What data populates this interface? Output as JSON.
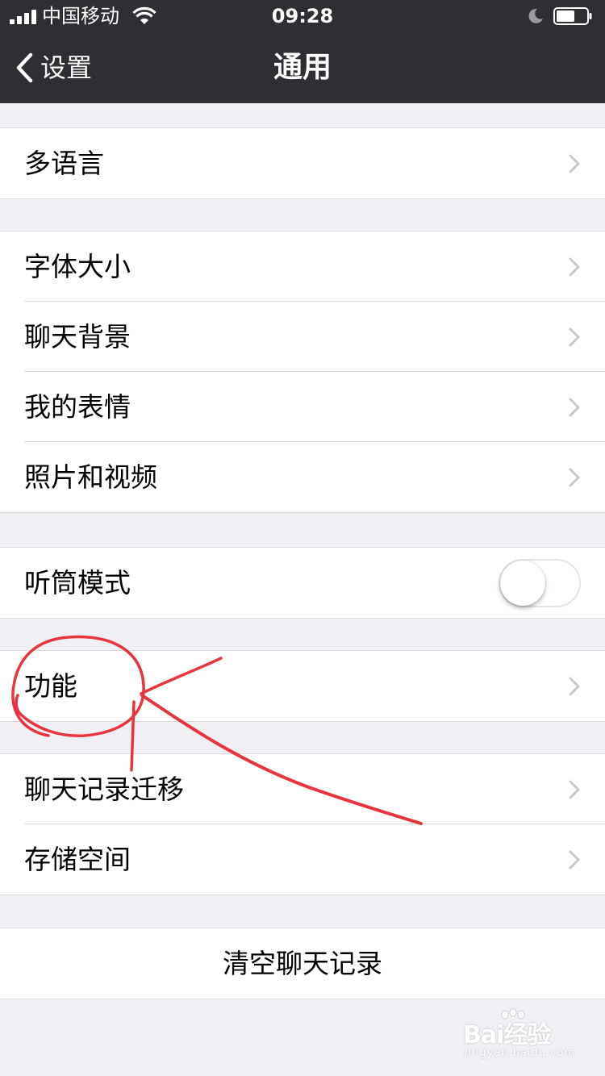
{
  "status_bar": {
    "carrier": "中国移动",
    "time": "09:28"
  },
  "nav": {
    "back_label": "设置",
    "title": "通用"
  },
  "settings": {
    "multilanguage": "多语言",
    "font_size": "字体大小",
    "chat_background": "聊天背景",
    "my_stickers": "我的表情",
    "photos_videos": "照片和视频",
    "earpiece_mode": "听筒模式",
    "earpiece_mode_enabled": false,
    "features": "功能",
    "chat_history_migration": "聊天记录迁移",
    "storage": "存储空间",
    "clear_chat_history": "清空聊天记录"
  },
  "watermark": {
    "brand": "Bai经验",
    "url": "jingyan.baidu.com"
  },
  "colors": {
    "navbar": "#2e2e33",
    "background": "#efeff4",
    "annotation": "#e8343f"
  }
}
